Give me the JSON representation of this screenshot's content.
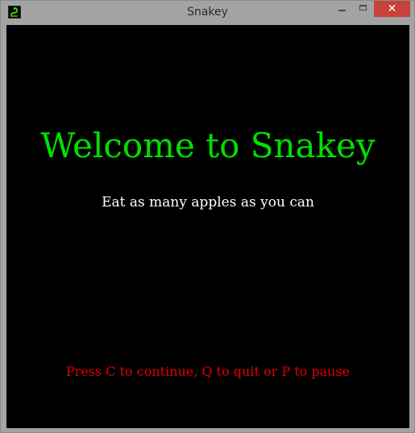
{
  "window": {
    "title": "Snakey",
    "icon": "snake-icon",
    "controls": {
      "minimize": "minimize-icon",
      "maximize": "maximize-icon",
      "close": "✕"
    }
  },
  "game": {
    "welcome_text": "Welcome to Snakey",
    "subtitle": "Eat as many apples as you can",
    "instructions": "Press C to continue, Q to quit or P to pause"
  },
  "colors": {
    "background": "#000000",
    "welcome": "#00e000",
    "subtitle": "#ffffff",
    "instructions": "#e00000",
    "close_button": "#c7423a"
  }
}
